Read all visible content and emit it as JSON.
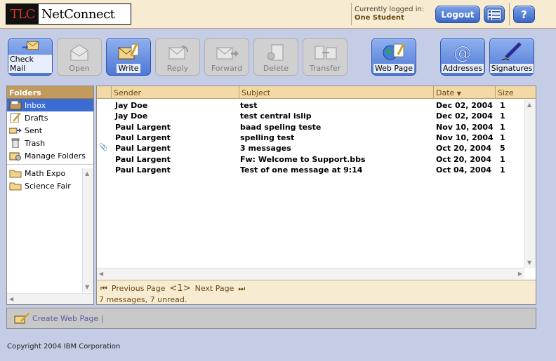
{
  "header": {
    "logo_tlc": "TLC",
    "logo_net": "NetConnect",
    "logged_label": "Currently logged in:",
    "logged_user": "One Student",
    "logout_label": "Logout",
    "help_label": "?"
  },
  "toolbar": {
    "check_mail": "Check Mail",
    "open": "Open",
    "write": "Write",
    "reply": "Reply",
    "forward": "Forward",
    "delete": "Delete",
    "transfer": "Transfer",
    "web_page": "Web Page",
    "addresses": "Addresses",
    "signatures": "Signatures"
  },
  "folders": {
    "title": "Folders",
    "items": [
      {
        "label": "Inbox",
        "icon": "inbox-icon"
      },
      {
        "label": "Drafts",
        "icon": "drafts-icon"
      },
      {
        "label": "Sent",
        "icon": "sent-icon"
      },
      {
        "label": "Trash",
        "icon": "trash-icon"
      },
      {
        "label": "Manage Folders",
        "icon": "manage-folders-icon"
      }
    ],
    "custom": [
      {
        "label": "Math Expo"
      },
      {
        "label": "Science Fair"
      }
    ]
  },
  "messages": {
    "columns": {
      "sender": "Sender",
      "subject": "Subject",
      "date": "Date",
      "size": "Size"
    },
    "rows": [
      {
        "sender": "Jay Doe",
        "subject": "test",
        "date": "Dec 02, 2004",
        "size": "1",
        "attachment": false
      },
      {
        "sender": "Jay Doe",
        "subject": "test central islip",
        "date": "Dec 02, 2004",
        "size": "1",
        "attachment": false
      },
      {
        "sender": "Paul Largent",
        "subject": "baad speling teste",
        "date": "Nov 10, 2004",
        "size": "1",
        "attachment": false
      },
      {
        "sender": "Paul Largent",
        "subject": "spelling test",
        "date": "Nov 10, 2004",
        "size": "1",
        "attachment": false
      },
      {
        "sender": "Paul Largent",
        "subject": "3 messages",
        "date": "Oct 20, 2004",
        "size": "5",
        "attachment": true
      },
      {
        "sender": "Paul Largent",
        "subject": "Fw: Welcome to Support.bbs",
        "date": "Oct 20, 2004",
        "size": "1",
        "attachment": false
      },
      {
        "sender": "Paul Largent",
        "subject": "Test of one message at 9:14",
        "date": "Oct 04, 2004",
        "size": "1",
        "attachment": false
      }
    ]
  },
  "pager": {
    "prev": "Previous Page",
    "page": "<1>",
    "next": "Next Page",
    "count": "7 messages, 7 unread."
  },
  "webbar": {
    "create": "Create Web Page"
  },
  "footer": {
    "copyright": "Copyright 2004 IBM Corporation"
  },
  "colors": {
    "accent": "#3a6cd4",
    "panel_header": "#c39a5e",
    "column_header": "#f3d9a6"
  }
}
